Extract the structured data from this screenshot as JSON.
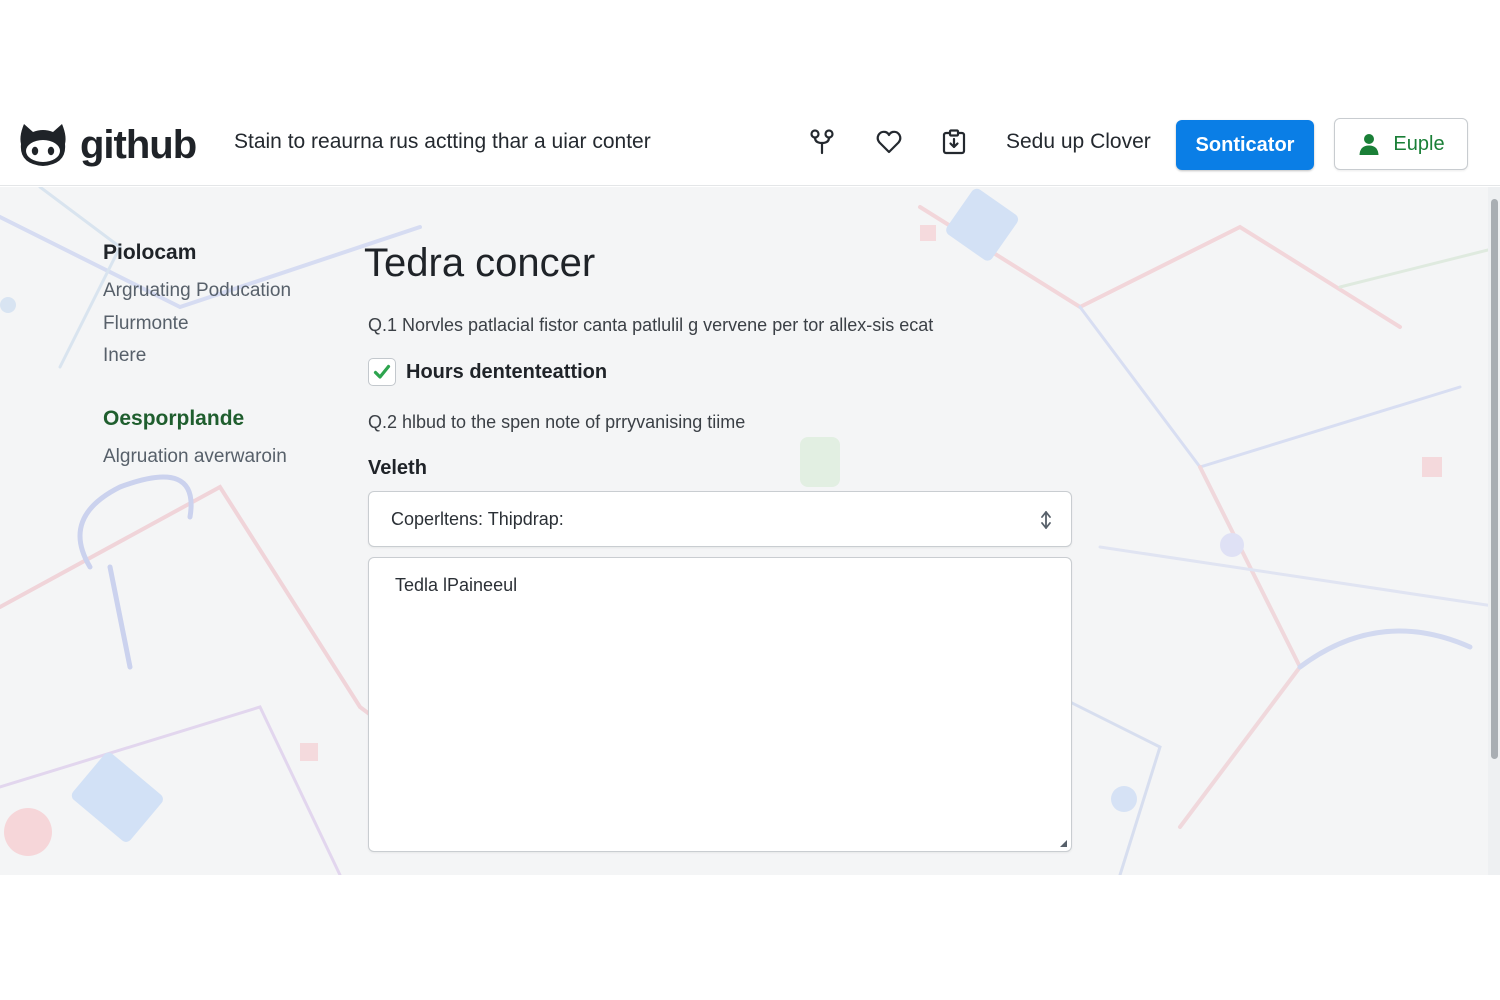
{
  "header": {
    "logo_text": "github",
    "tagline": "Stain to reaurna rus actting thar a uiar conter",
    "icons": [
      "fork-icon",
      "heart-icon",
      "clipboard-icon"
    ],
    "signup_link": "Sedu up Clover",
    "primary_button": "Sonticator",
    "user_button": "Euple"
  },
  "sidebar": {
    "section1": {
      "heading": "Piolocam",
      "items": [
        "Argruating Poducation",
        "Flurmonte",
        "Inere"
      ]
    },
    "section2": {
      "heading": "Oesporplande",
      "items": [
        "Algruation averwaroin"
      ]
    }
  },
  "main": {
    "title": "Tedra concer",
    "question1": "Q.1 Norvles patlacial fistor canta patlulil g vervene per tor allex-sis ecat",
    "checkbox": {
      "label": "Hours dententeattion",
      "checked": true
    },
    "question2": "Q.2 hlbud to the spen note of prryvanising tiime",
    "field_label": "Veleth",
    "select_value": "Coperltens: Thipdrap:",
    "textarea_value": "Tedla lPaineeul"
  },
  "colors": {
    "primary_button": "#0a7ee6",
    "user_button_text": "#1a7f37",
    "checkmark": "#2da44e",
    "section2_heading": "#1f5e2e"
  }
}
